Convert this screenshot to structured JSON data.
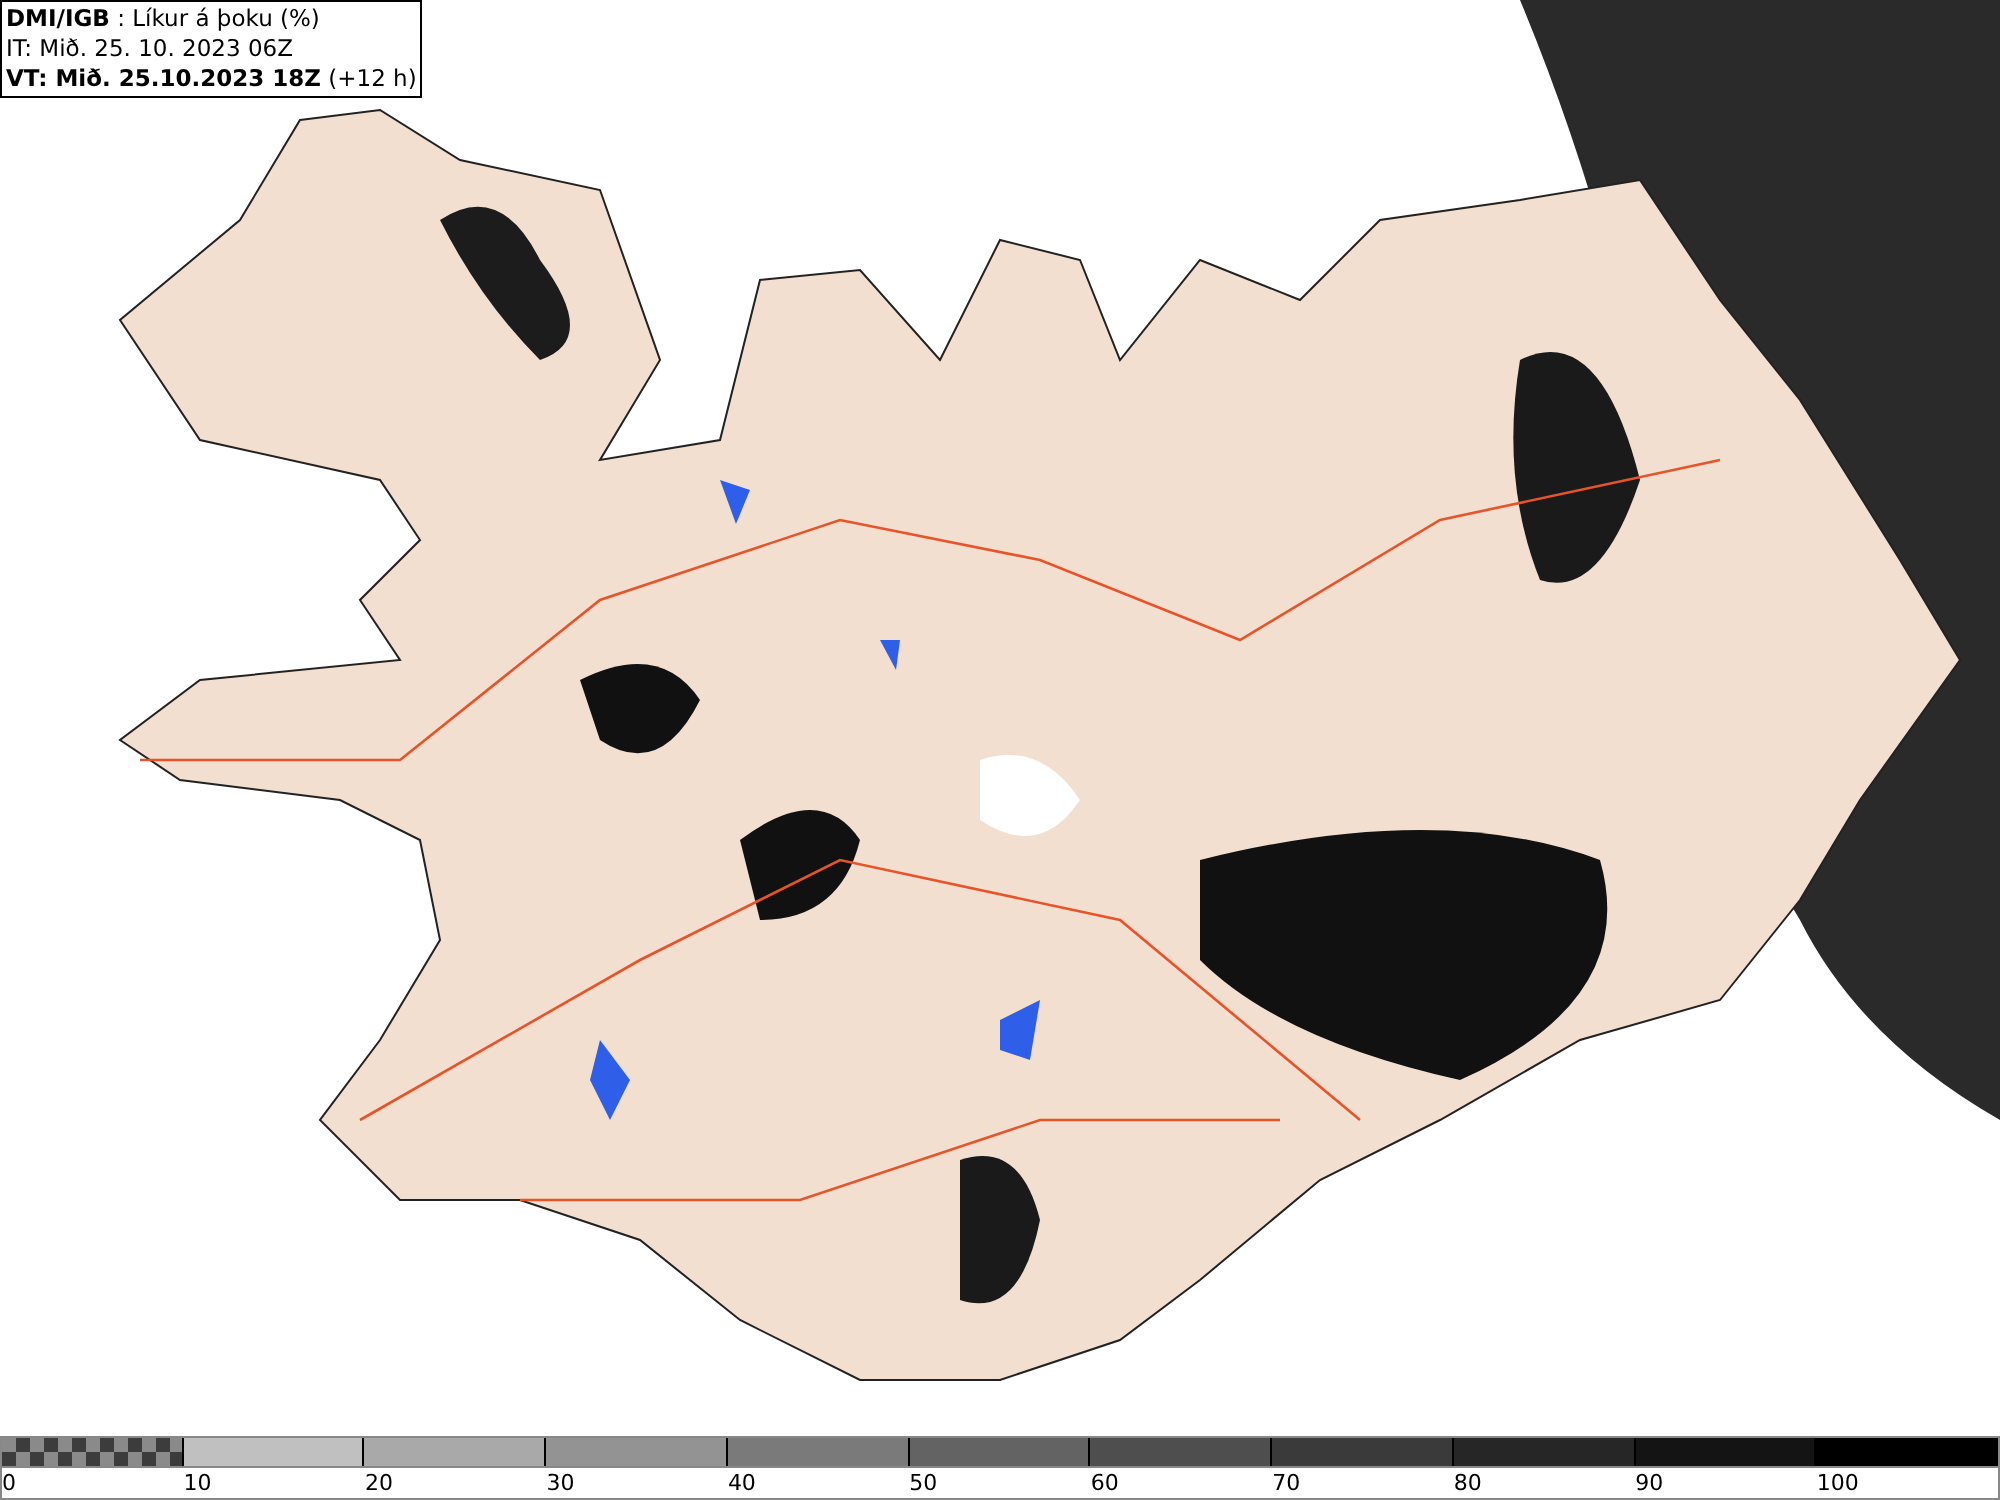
{
  "header": {
    "lines": [
      "**DMI/IGB** : Líkur á þoku (%)",
      "IT: Mið. 25. 10. 2023 06Z",
      "**VT: Mið. 25.10.2023 18Z** (+12 h)"
    ]
  },
  "legend": [
    {
      "label": "0",
      "kind": "checkered"
    },
    {
      "label": "10",
      "kind": "solid",
      "color": "#c0c0c0"
    },
    {
      "label": "20",
      "kind": "solid",
      "color": "#a9a9a9"
    },
    {
      "label": "30",
      "kind": "solid",
      "color": "#939393"
    },
    {
      "label": "40",
      "kind": "solid",
      "color": "#7a7a7a"
    },
    {
      "label": "50",
      "kind": "solid",
      "color": "#636363"
    },
    {
      "label": "60",
      "kind": "solid",
      "color": "#4e4e4e"
    },
    {
      "label": "70",
      "kind": "solid",
      "color": "#3a3a3a"
    },
    {
      "label": "80",
      "kind": "solid",
      "color": "#262626"
    },
    {
      "label": "90",
      "kind": "solid",
      "color": "#141414"
    },
    {
      "label": "100",
      "kind": "solid",
      "color": "#000000"
    }
  ]
}
